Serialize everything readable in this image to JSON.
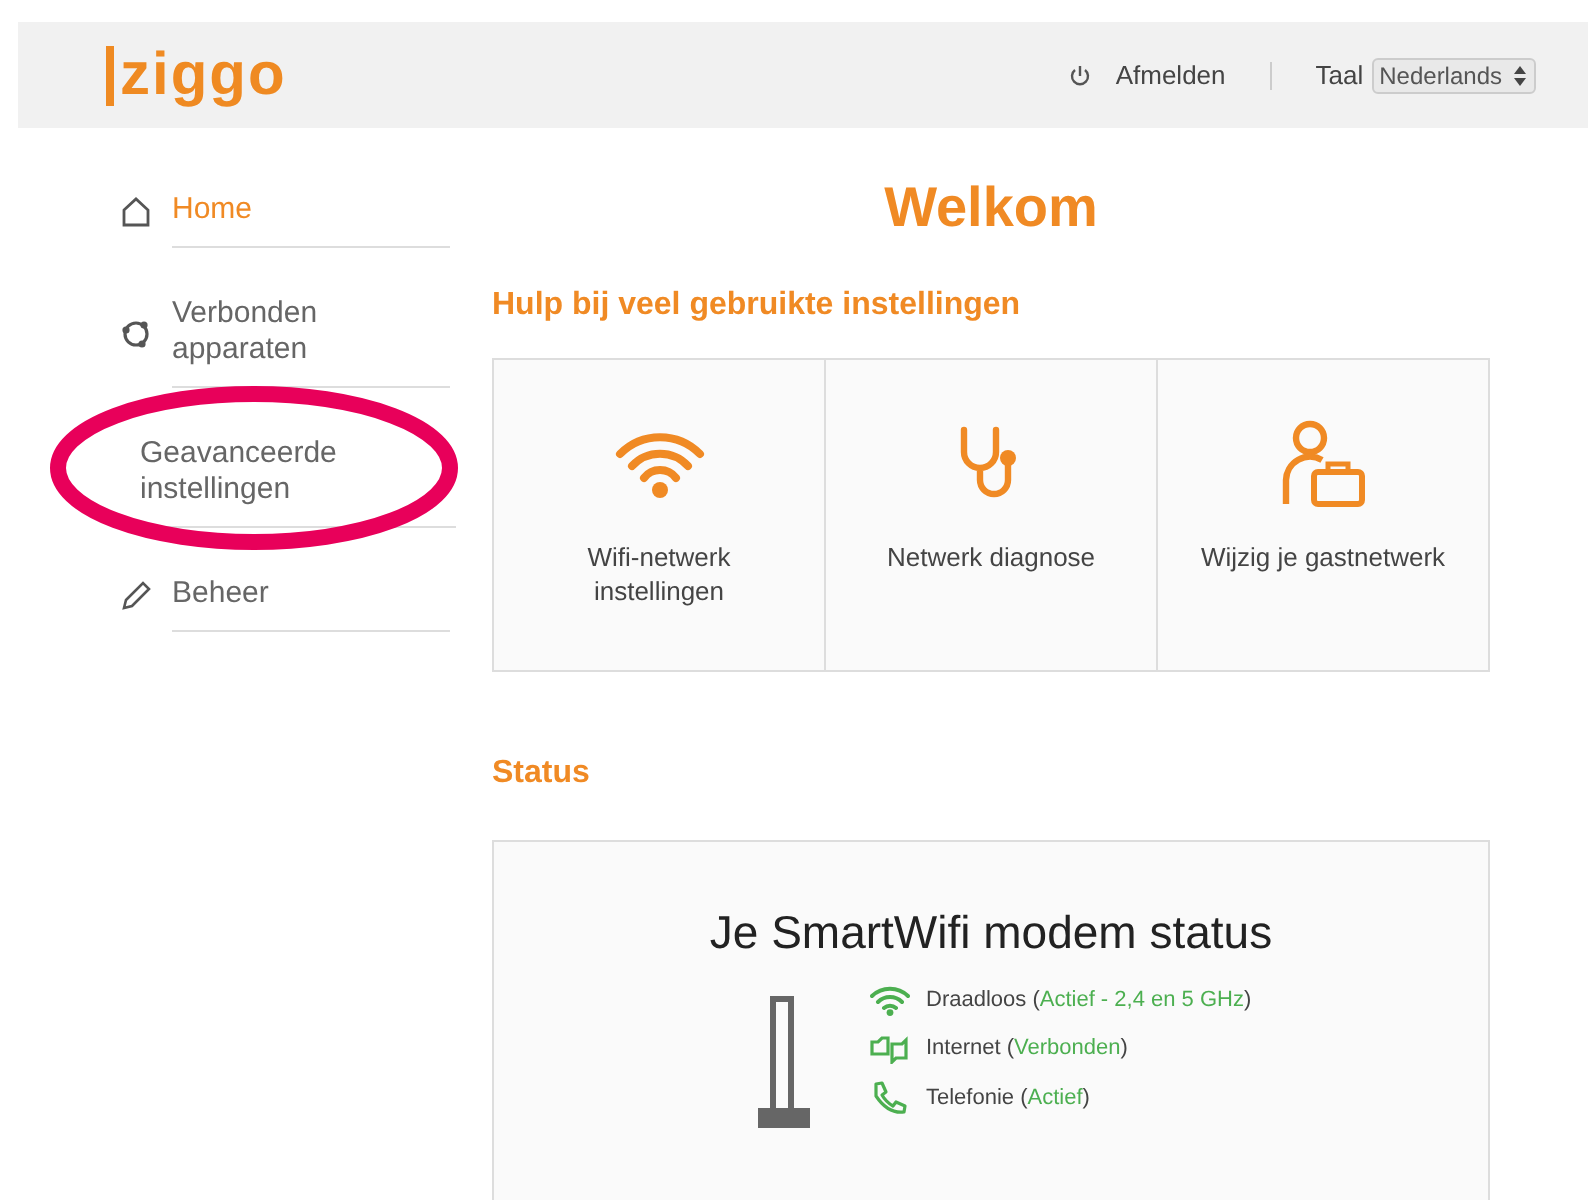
{
  "header": {
    "logo": "ziggo",
    "logout": "Afmelden",
    "language_label": "Taal",
    "language": "Nederlands"
  },
  "sidebar": {
    "items": [
      {
        "label": "Home",
        "kind": "home",
        "selected": true,
        "highlighted": false
      },
      {
        "label": "Verbonden apparaten",
        "kind": "devices",
        "selected": false,
        "highlighted": false
      },
      {
        "label": "Geavanceerde instellingen",
        "kind": "settings",
        "selected": false,
        "highlighted": true
      },
      {
        "label": "Beheer",
        "kind": "admin",
        "selected": false,
        "highlighted": false
      }
    ]
  },
  "title": "Welkom",
  "quick_settings": {
    "heading": "Hulp bij veel gebruikte instellingen",
    "cards": [
      {
        "label": "Wifi-netwerk instellingen",
        "kind": "wifi"
      },
      {
        "label": "Netwerk diagnose",
        "kind": "diagnosis"
      },
      {
        "label": "Wijzig je gastnetwerk",
        "kind": "guest"
      }
    ]
  },
  "status": {
    "heading": "Status",
    "card_title": "Je SmartWifi modem status",
    "rows": [
      {
        "kind": "wireless",
        "label": "Draadloos (",
        "status": "Actief - 2,4 en 5 GHz",
        "suffix": ")"
      },
      {
        "kind": "internet",
        "label": "Internet (",
        "status": "Verbonden",
        "suffix": ")"
      },
      {
        "kind": "telephony",
        "label": "Telefonie (",
        "status": "Actief",
        "suffix": ")"
      }
    ]
  }
}
